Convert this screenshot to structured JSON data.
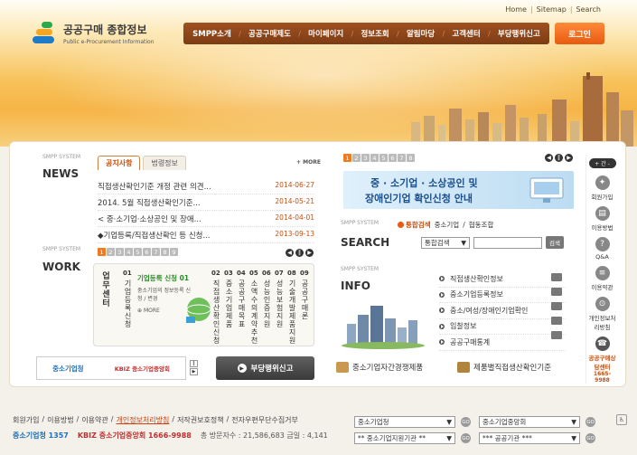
{
  "utility": [
    "Home",
    "Sitemap",
    "Search"
  ],
  "logo": {
    "title": "공공구매 종합정보",
    "subtitle": "Public e-Procurement Information"
  },
  "gnb": [
    "SMPP소개",
    "공공구매제도",
    "마이페이지",
    "정보조회",
    "알림마당",
    "고객센터",
    "부당행위신고"
  ],
  "login_label": "로그인",
  "news": {
    "tag": "SMPP SYSTEM",
    "title": "NEWS",
    "tabs": [
      "공지사항",
      "법령정보"
    ],
    "more": "MORE",
    "items": [
      {
        "text": "직접생산확인기준 개정 관련 의견...",
        "date": "2014-06-27"
      },
      {
        "text": "2014. 5월 직접생산확인기준...",
        "date": "2014-05-21"
      },
      {
        "text": "< 중·소기업·소상공인 및 장애...",
        "date": "2014-04-01"
      },
      {
        "text": "◆기업등록/직접생산확인 등 신청...",
        "date": "2013-09-13"
      }
    ]
  },
  "work": {
    "tag": "SMPP SYSTEM",
    "title": "WORK",
    "pages": [
      "1",
      "2",
      "3",
      "4",
      "5",
      "6",
      "7",
      "8",
      "9"
    ],
    "side_label": "업무센터",
    "feature_title": "기업등록 신청 01",
    "feature_desc": "중소기업의 정보등록 신청 / 변경",
    "feature_more": "MORE",
    "columns": [
      {
        "num": "01",
        "label": "기업등록신청"
      },
      {
        "num": "02",
        "label": "직접생산확인신청"
      },
      {
        "num": "03",
        "label": "중소기업제품"
      },
      {
        "num": "04",
        "label": "공공구매목표"
      },
      {
        "num": "05",
        "label": "소액수의계약추천"
      },
      {
        "num": "06",
        "label": "성능인증지원"
      },
      {
        "num": "07",
        "label": "성능보험지원"
      },
      {
        "num": "08",
        "label": "기술개발제품지원"
      },
      {
        "num": "09",
        "label": "공공구매론"
      }
    ]
  },
  "bottom_banner": {
    "logo1": "중소기업청",
    "logo2": "KBIZ 중소기업중앙회",
    "report": "부당행위신고"
  },
  "promo": {
    "pages": [
      "1",
      "2",
      "3",
      "4",
      "5",
      "6",
      "7",
      "8"
    ],
    "line1": "중 · 소기업 · 소상공인 및",
    "line2": "장애인기업 확인신청 안내"
  },
  "search": {
    "tag": "SMPP SYSTEM",
    "title": "SEARCH",
    "radios": [
      "통합검색",
      "중소기업",
      "협동조합"
    ],
    "select": "통합검색",
    "button": "검색"
  },
  "info": {
    "tag": "SMPP SYSTEM",
    "title": "INFO",
    "items": [
      "직접생산확인정보",
      "중소기업등록정보",
      "중소/여성/장애인기업확인",
      "입찰정보",
      "공공구매통계"
    ],
    "link1": "중소기업자간경쟁제품",
    "link2": "제품별직접생산확인기준"
  },
  "quick": {
    "badge": "+ 간 -",
    "items": [
      "회원가입",
      "이용방법",
      "Q&A",
      "이용약관",
      "개인정보처리방침"
    ],
    "center_title": "공공구매상담센터",
    "center_phone": "1665-9988"
  },
  "footer": {
    "links": [
      "회원가입",
      "이용방법",
      "이용약관",
      "개인정보처리방침",
      "저작권보호정책",
      "전자우편무단수집거부"
    ],
    "logo1": "중소기업청 1357",
    "logo2": "KBIZ 중소기업중앙회 1666-9988",
    "stats": "총 방문자수 : 21,586,683  금일 : 4,141",
    "selects": [
      "중소기업청",
      "중소기업중앙회",
      "** 중소기업지원기관 **",
      "*** 공공기관 ***"
    ]
  },
  "colors": {
    "accent": "#e85a10",
    "gnb": "#7d3c14",
    "date": "#c85010"
  }
}
